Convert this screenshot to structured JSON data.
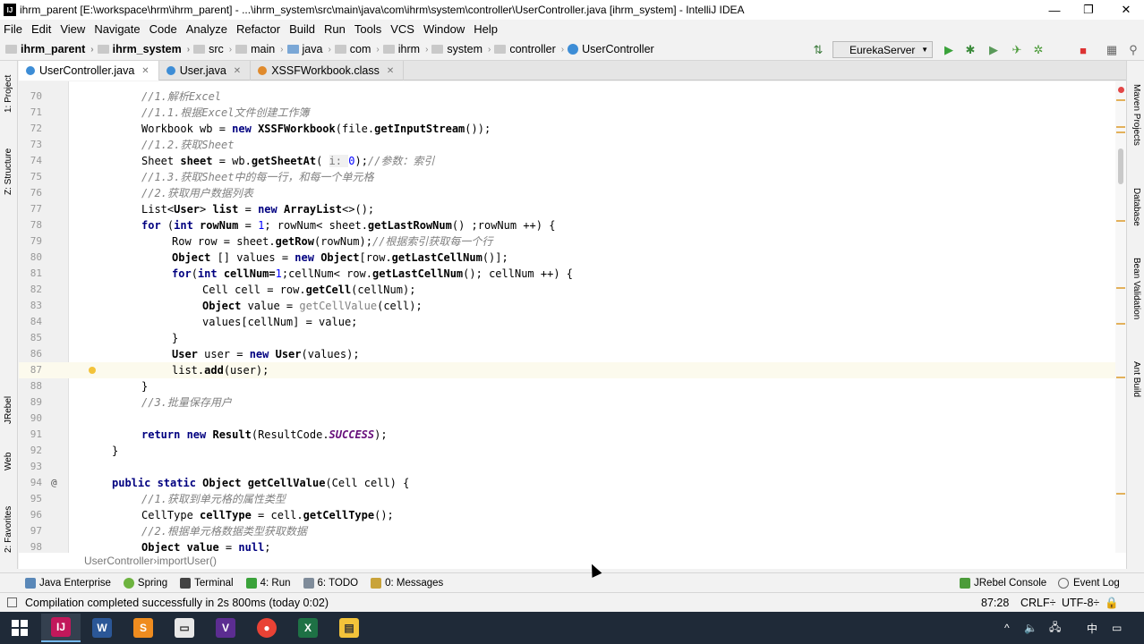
{
  "window": {
    "title": "ihrm_parent [E:\\workspace\\hrm\\ihrm_parent] - ...\\ihrm_system\\src\\main\\java\\com\\ihrm\\system\\controller\\UserController.java [ihrm_system] - IntelliJ IDEA",
    "minimize": "—",
    "maximize": "❐",
    "close": "✕"
  },
  "menu": [
    "File",
    "Edit",
    "View",
    "Navigate",
    "Code",
    "Analyze",
    "Refactor",
    "Build",
    "Run",
    "Tools",
    "VCS",
    "Window",
    "Help"
  ],
  "breadcrumbs": [
    "ihrm_parent",
    "ihrm_system",
    "src",
    "main",
    "java",
    "com",
    "ihrm",
    "system",
    "controller",
    "UserController"
  ],
  "run_config": "EurekaServer",
  "tabs": [
    {
      "label": "UserController.java",
      "active": true,
      "color": "#3d8dd6"
    },
    {
      "label": "User.java",
      "active": false,
      "color": "#3d8dd6"
    },
    {
      "label": "XSSFWorkbook.class",
      "active": false,
      "color": "#e08a2c"
    }
  ],
  "left_tools": [
    "1: Project",
    "Z: Structure",
    "JRebel",
    "Web",
    "2: Favorites"
  ],
  "right_tools": [
    "Maven Projects",
    "Database",
    "Bean Validation",
    "Ant Build"
  ],
  "editor": {
    "line_numbers": [
      "70",
      "71",
      "72",
      "73",
      "74",
      "75",
      "76",
      "77",
      "78",
      "79",
      "80",
      "81",
      "82",
      "83",
      "84",
      "85",
      "86",
      "87",
      "88",
      "89",
      "90",
      "91",
      "92",
      "93",
      "94",
      "95",
      "96",
      "97",
      "98"
    ],
    "lines": {
      "l70": "//1.解析Excel",
      "l71": "//1.1.根据Excel文件创建工作簿",
      "l72a": "Workbook wb = ",
      "l72b": "new ",
      "l72c": "XSSFWorkbook",
      "l72d": "(file.",
      "l72e": "getInputStream",
      "l72f": "());",
      "l73": "//1.2.获取Sheet",
      "l74a": "Sheet ",
      "l74b": "sheet",
      "l74c": " = wb.",
      "l74d": "getSheetAt",
      "l74e": "( ",
      "l74f": "i: ",
      "l74g": "0",
      "l74h": ");",
      "l74i": "//参数：索引",
      "l75": "//1.3.获取Sheet中的每一行，和每一个单元格",
      "l76": "//2.获取用户数据列表",
      "l77a": "List<",
      "l77b": "User",
      "l77c": "> ",
      "l77d": "list",
      "l77e": " = ",
      "l77f": "new ",
      "l77g": "ArrayList",
      "l77h": "<>();",
      "l78a": "for ",
      "l78b": "(",
      "l78c": "int ",
      "l78d": "rowNum",
      "l78e": " = ",
      "l78f": "1",
      "l78g": "; rowNum< sheet.",
      "l78h": "getLastRowNum",
      "l78i": "() ;rowNum ++) {",
      "l79a": "Row row = sheet.",
      "l79b": "getRow",
      "l79c": "(rowNum);",
      "l79d": "//根据索引获取每一个行",
      "l80a": "Object",
      "l80b": " [] values = ",
      "l80c": "new ",
      "l80d": "Object",
      "l80e": "[row.",
      "l80f": "getLastCellNum",
      "l80g": "()];",
      "l81a": "for",
      "l81b": "(",
      "l81c": "int ",
      "l81d": "cellNum=",
      "l81e": "1",
      "l81f": ";cellNum< row.",
      "l81g": "getLastCellNum",
      "l81h": "(); cellNum ++) {",
      "l82a": "Cell cell = row.",
      "l82b": "getCell",
      "l82c": "(cellNum);",
      "l83a": "Object",
      "l83b": " value = ",
      "l83c": "getCellValue",
      "l83d": "(cell);",
      "l84": "values[cellNum] = value;",
      "l85": "}",
      "l86a": "User",
      "l86b": " user = ",
      "l86c": "new ",
      "l86d": "User",
      "l86e": "(values);",
      "l87a": "list.",
      "l87b": "add",
      "l87c": "(user);",
      "l88": "}",
      "l89": "//3.批量保存用户",
      "l90": "",
      "l91a": "return ",
      "l91b": "new ",
      "l91c": "Result",
      "l91d": "(ResultCode.",
      "l91e": "SUCCESS",
      "l91f": ");",
      "l92": "}",
      "l93": "",
      "l94a": "public static ",
      "l94b": "Object ",
      "l94c": "getCellValue",
      "l94d": "(Cell cell) {",
      "l95": "//1.获取到单元格的属性类型",
      "l96a": "CellType ",
      "l96b": "cellType",
      "l96c": " = cell.",
      "l96d": "getCellType",
      "l96e": "();",
      "l97": "//2.根据单元格数据类型获取数据",
      "l98a": "Object ",
      "l98b": "value",
      "l98c": " = ",
      "l98d": "null",
      "l98e": ";"
    },
    "gutter_marker_94": "@"
  },
  "editor_breadcrumb": {
    "cls": "UserController",
    "sep": " › ",
    "method": "importUser()"
  },
  "bottom_tools": [
    "Java Enterprise",
    "Spring",
    "Terminal",
    "4: Run",
    "6: TODO",
    "0: Messages"
  ],
  "bottom_tools_right": [
    "JRebel Console",
    "Event Log"
  ],
  "status": {
    "message": "Compilation completed successfully in 2s 800ms (today 0:02)",
    "position": "87:28",
    "line_sep": "CRLF÷",
    "encoding": "UTF-8÷"
  },
  "taskbar": {
    "apps": [
      "IntelliJ IDEA",
      "Word",
      "Sublime",
      "Explorer window",
      "Visual Studio",
      "Chrome",
      "Excel",
      "File Explorer"
    ],
    "tray_icons": [
      "^",
      "🔈",
      "🖧",
      "中"
    ],
    "time": ""
  },
  "colors": {
    "keyword": "#000080",
    "comment": "#808080",
    "static_field": "#660e7a",
    "number": "#0000ff",
    "taskbar": "#1f2a38"
  }
}
